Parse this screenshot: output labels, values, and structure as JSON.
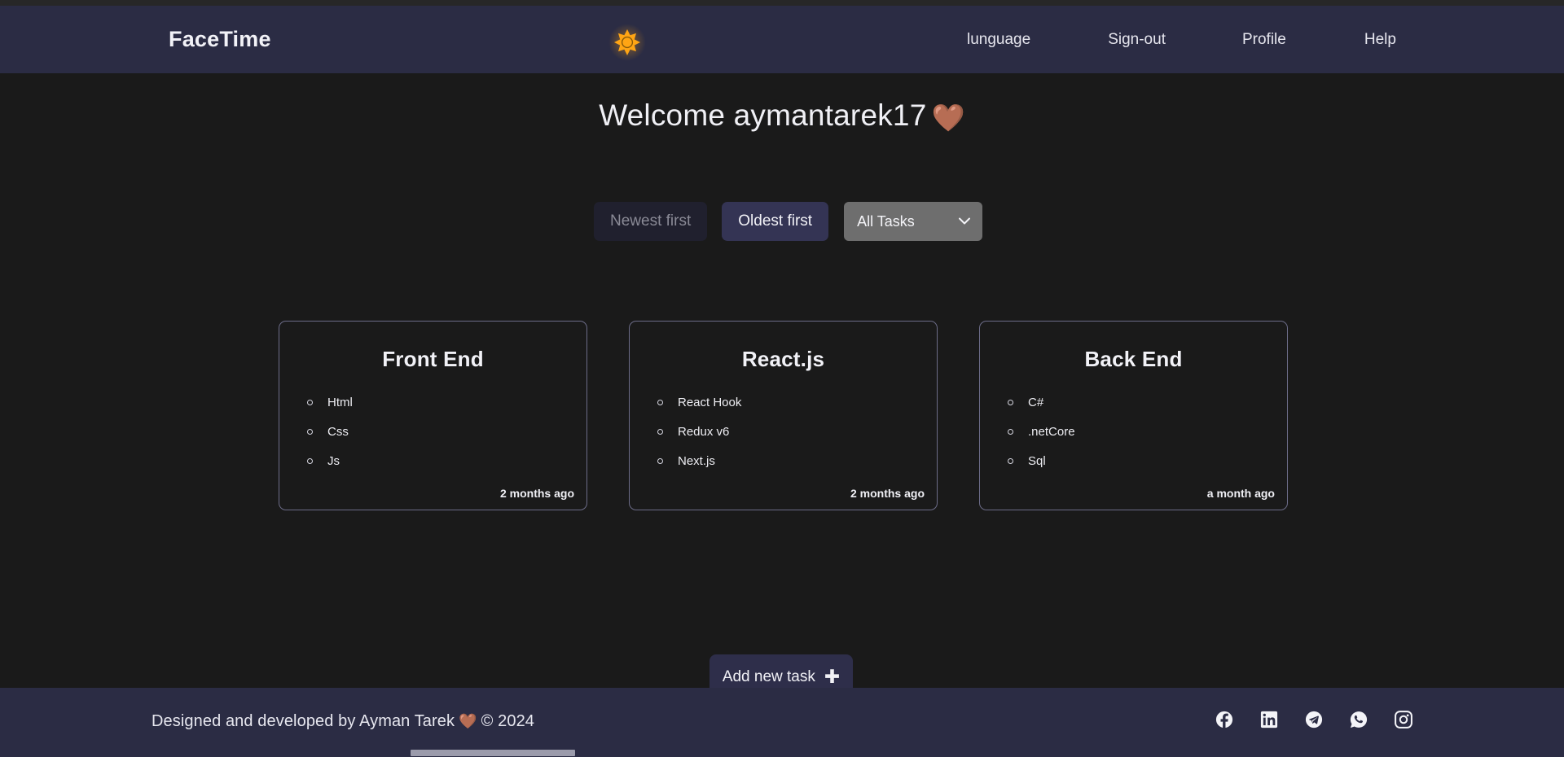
{
  "navbar": {
    "brand": "FaceTime",
    "theme_toggle_icon": "sun-icon",
    "links": [
      {
        "label": "lunguage"
      },
      {
        "label": "Sign-out"
      },
      {
        "label": "Profile"
      },
      {
        "label": "Help"
      }
    ]
  },
  "main": {
    "welcome_text": "Welcome aymantarek17",
    "welcome_heart": "🤎",
    "controls": {
      "newest_first_label": "Newest first",
      "oldest_first_label": "Oldest first",
      "filter_selected": "All Tasks",
      "filter_options": [
        "All Tasks"
      ]
    },
    "cards": [
      {
        "title": "Front End",
        "items": [
          "Html",
          "Css",
          "Js"
        ],
        "time": "2 months ago"
      },
      {
        "title": "React.js",
        "items": [
          "React Hook",
          "Redux v6",
          "Next.js"
        ],
        "time": "2 months ago"
      },
      {
        "title": "Back End",
        "items": [
          "C#",
          ".netCore",
          "Sql"
        ],
        "time": "a month ago"
      }
    ],
    "add_task_label": "Add new task",
    "add_task_icon": "plus-icon"
  },
  "footer": {
    "credit_prefix": "Designed and developed by Ayman Tarek",
    "credit_heart": "🤎",
    "credit_suffix": "© 2024",
    "socials": [
      {
        "name": "facebook-icon"
      },
      {
        "name": "linkedin-icon"
      },
      {
        "name": "telegram-icon"
      },
      {
        "name": "whatsapp-icon"
      },
      {
        "name": "instagram-icon"
      }
    ]
  },
  "colors": {
    "navbar_bg": "#2b2c44",
    "page_bg": "#1a1a1a",
    "accent": "#343454",
    "sun": "#ffa514",
    "card_border": "#6c6c88",
    "muted_text": "#8a8a96"
  }
}
